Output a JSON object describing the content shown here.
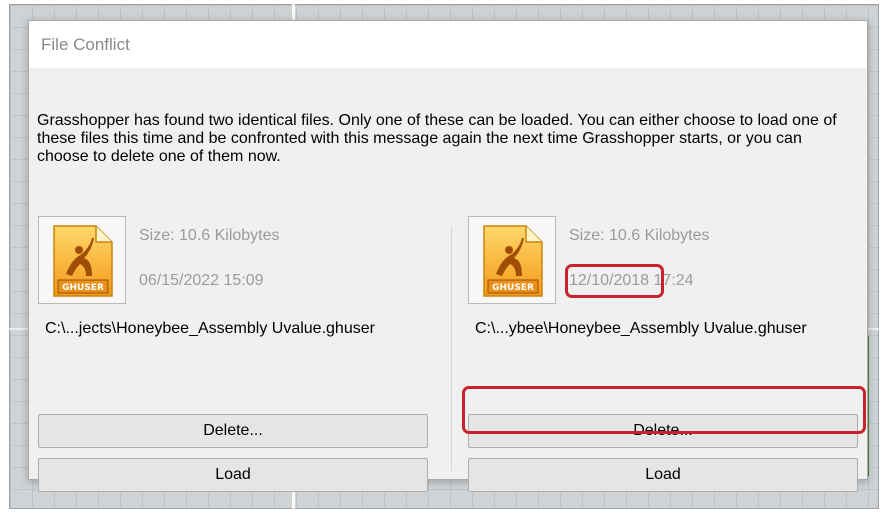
{
  "dialog": {
    "title": "File Conflict",
    "message": "Grasshopper has found two identical files. Only one of these can be loaded. You can either choose to load one of these files this time and be confronted with this message again the next time Grasshopper starts, or you can choose to delete one of them now."
  },
  "files": [
    {
      "icon_label": "GHUSER",
      "size": "Size: 10.6 Kilobytes",
      "date": "06/15/2022 15:09",
      "path": "C:\\...jects\\Honeybee_Assembly Uvalue.ghuser",
      "delete_label": "Delete...",
      "load_label": "Load"
    },
    {
      "icon_label": "GHUSER",
      "size": "Size: 10.6 Kilobytes",
      "date": "12/10/2018 17:24",
      "path": "C:\\...ybee\\Honeybee_Assembly Uvalue.ghuser",
      "delete_label": "Delete...",
      "load_label": "Load"
    }
  ],
  "annotations": {
    "highlight_color": "#c8232c"
  },
  "icons": {
    "file": "ghuser-file-icon"
  }
}
